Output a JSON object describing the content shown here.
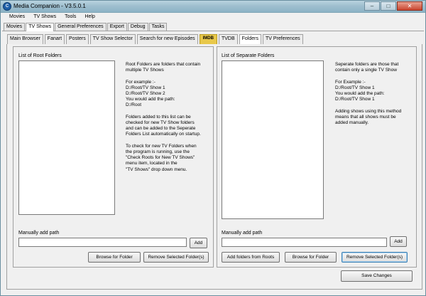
{
  "window": {
    "title": "Media Companion - V3.5.0.1",
    "icon_glyph": "C"
  },
  "menu": [
    "Movies",
    "TV Shows",
    "Tools",
    "Help"
  ],
  "main_tabs": [
    {
      "label": "Movies",
      "active": false
    },
    {
      "label": "TV Shows",
      "active": true
    },
    {
      "label": "General Preferences",
      "active": false
    },
    {
      "label": "Export",
      "active": false
    },
    {
      "label": "Debug",
      "active": false
    },
    {
      "label": "Tasks",
      "active": false
    }
  ],
  "sub_tabs": [
    {
      "label": "Main Browser",
      "active": false
    },
    {
      "label": "Fanart",
      "active": false
    },
    {
      "label": "Posters",
      "active": false
    },
    {
      "label": "TV Show Selector",
      "active": false
    },
    {
      "label": "Search for new Episodes",
      "active": false
    },
    {
      "label": "IMDB",
      "active": false
    },
    {
      "label": "TVDB",
      "active": false
    },
    {
      "label": "Folders",
      "active": true
    },
    {
      "label": "TV Preferences",
      "active": false
    }
  ],
  "root_panel": {
    "list_label": "List of Root Folders",
    "description": "Root Folders are folders that contain\nmultiple TV Shows\n\nFor example :-\nD:/Root/TV Show 1\nD:/Root/TV Show 2\nYou would add the path:\nD:/Root\n\nFolders added to this list can be\nchecked for new TV Show folders\nand can be added to the Seperate\nFolders List automatically on startup.\n\nTo check for new TV Folders when\nthe program is running, use the\n\"Check Roots for New TV Shows\"\nmenu item, located in the\n\"TV Shows\" drop down menu.",
    "manual_label": "Manually add path",
    "path_value": "",
    "add_button": "Add",
    "browse_button": "Browse for Folder",
    "remove_button": "Remove Selected Folder(s)"
  },
  "separate_panel": {
    "list_label": "List of Separate Folders",
    "description": "Seperate folders are those that\ncontain only a single TV Show\n\nFor Example :-\nD:/Root/TV Show 1\nYou would add the path:\nD:/Root/TV Show 1\n\nAdding shows using this method\nmeans that all shows must be\nadded manually.",
    "manual_label": "Manually add path",
    "path_value": "",
    "add_button": "Add",
    "add_from_roots_button": "Add folders from Roots",
    "browse_button": "Browse for Folder",
    "remove_button": "Remove Selected Folder(s)"
  },
  "save_button": "Save Changes"
}
